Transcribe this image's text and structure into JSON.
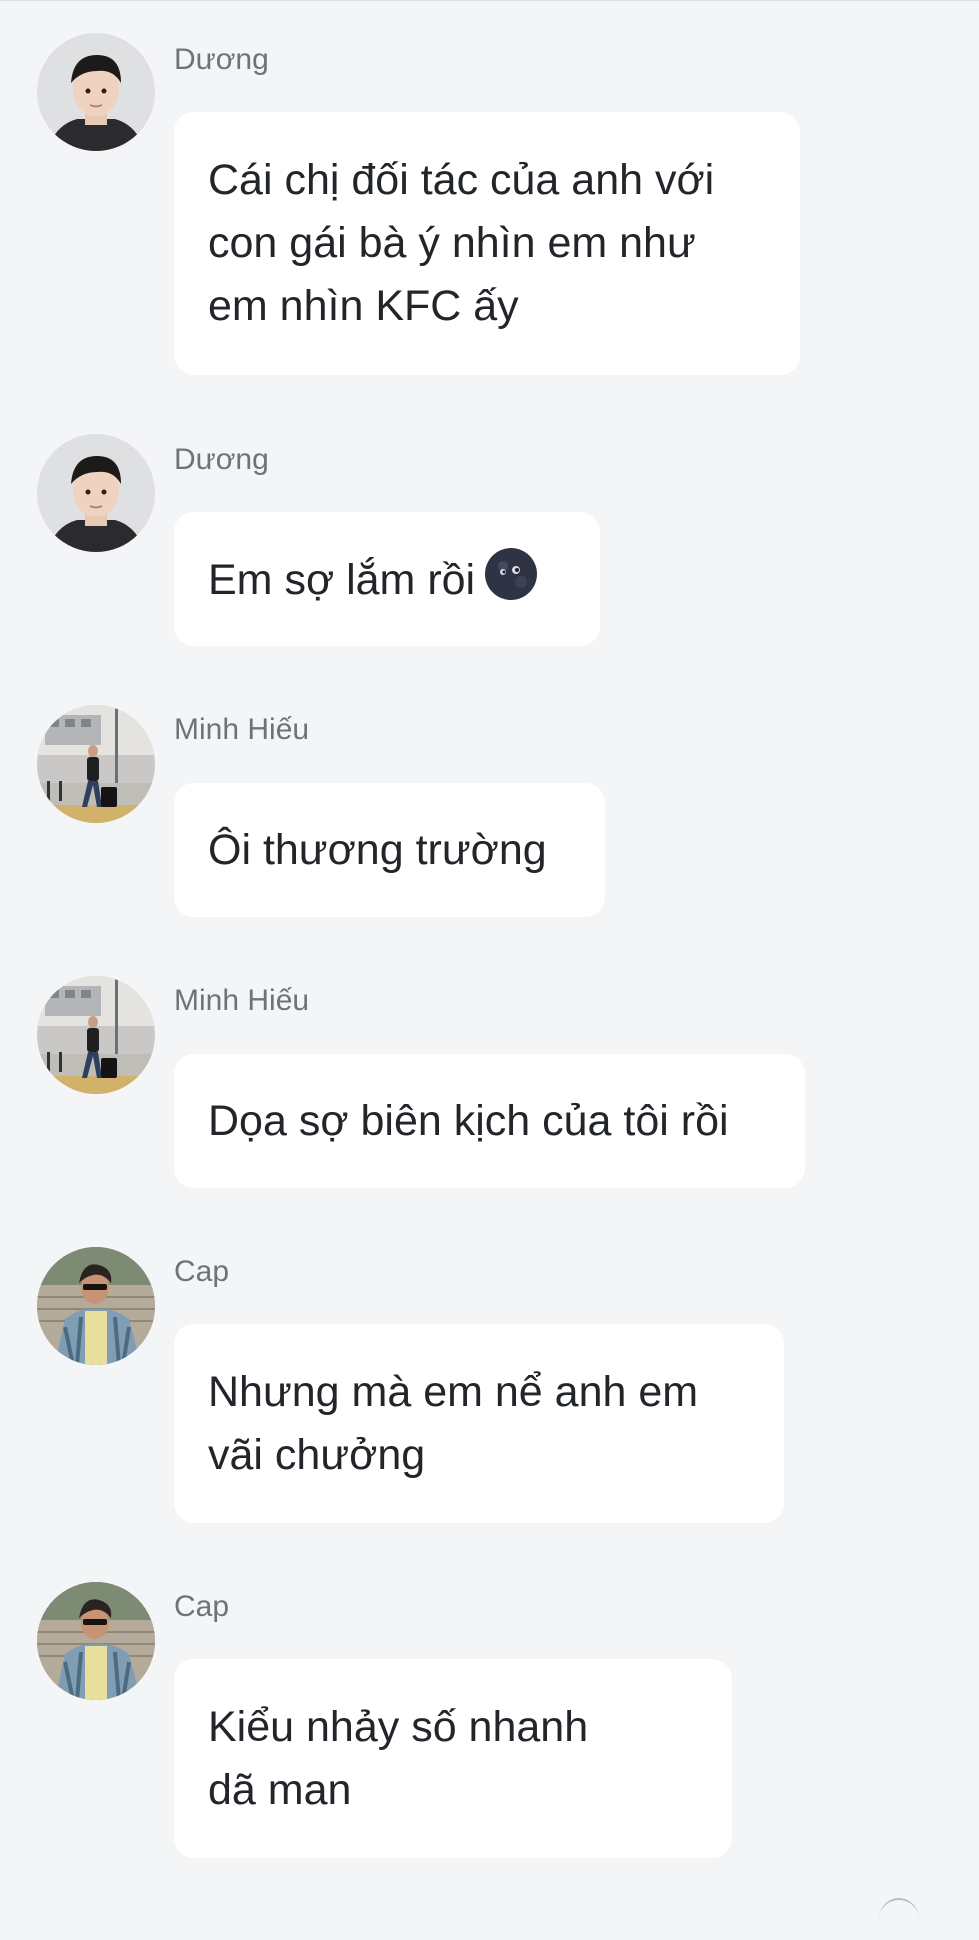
{
  "messages": [
    {
      "sender": "Dương",
      "text": "Cái chị đối tác của anh với con gái bà ý nhìn em như em nhìn KFC ấy",
      "avatar": "portrait-young-man"
    },
    {
      "sender": "Dương",
      "text": "Em sợ lắm rồi",
      "emoji": "new-moon-face",
      "avatar": "portrait-young-man"
    },
    {
      "sender": "Minh Hiếu",
      "text": "Ôi thương trường",
      "avatar": "man-walking-with-suitcase"
    },
    {
      "sender": "Minh Hiếu",
      "text": "Dọa sợ biên kịch của tôi rồi",
      "avatar": "man-walking-with-suitcase"
    },
    {
      "sender": "Cap",
      "text": "Nhưng mà em nể anh em vãi chưởng",
      "avatar": "man-with-sunglasses-patterned-shirt"
    },
    {
      "sender": "Cap",
      "text": "Kiểu nhảy số nhanh dã man",
      "avatar": "man-with-sunglasses-patterned-shirt"
    }
  ],
  "colors": {
    "background": "#f4f5f7",
    "bubble": "#ffffff",
    "sender_name": "#707376",
    "message_text": "#222529"
  }
}
